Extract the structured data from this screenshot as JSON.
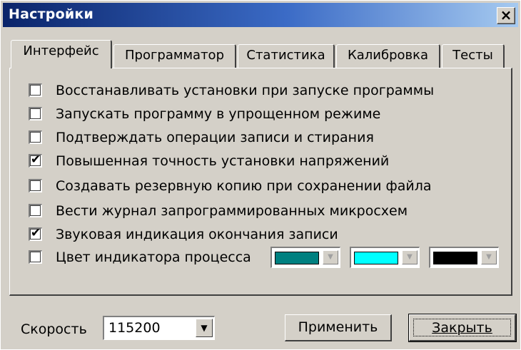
{
  "window": {
    "title": "Настройки"
  },
  "tabs": [
    {
      "label": "Интерфейс",
      "active": true
    },
    {
      "label": "Программатор",
      "active": false
    },
    {
      "label": "Статистика",
      "active": false
    },
    {
      "label": "Калибровка",
      "active": false
    },
    {
      "label": "Тесты",
      "active": false
    }
  ],
  "options": [
    {
      "label": "Восстанавливать установки при запуске программы",
      "checked": false
    },
    {
      "label": "Запускать программу в упрощенном режиме",
      "checked": false
    },
    {
      "label": "Подтверждать операции записи и стирания",
      "checked": false
    },
    {
      "label": "Повышенная точность установки напряжений",
      "checked": true
    },
    {
      "label": "Создавать резервную копию при сохранении файла",
      "checked": false
    },
    {
      "label": "Вести журнал запрограммированных микросхем",
      "checked": false
    },
    {
      "label": "Звуковая индикация окончания записи",
      "checked": true
    },
    {
      "label": "Цвет индикатора процесса",
      "checked": false
    }
  ],
  "check_mark": "✔",
  "colors": [
    "#008080",
    "#00ffff",
    "#000000"
  ],
  "speed": {
    "label": "Скорость",
    "value": "115200"
  },
  "buttons": {
    "apply": "Применить",
    "close": "Закрыть"
  }
}
